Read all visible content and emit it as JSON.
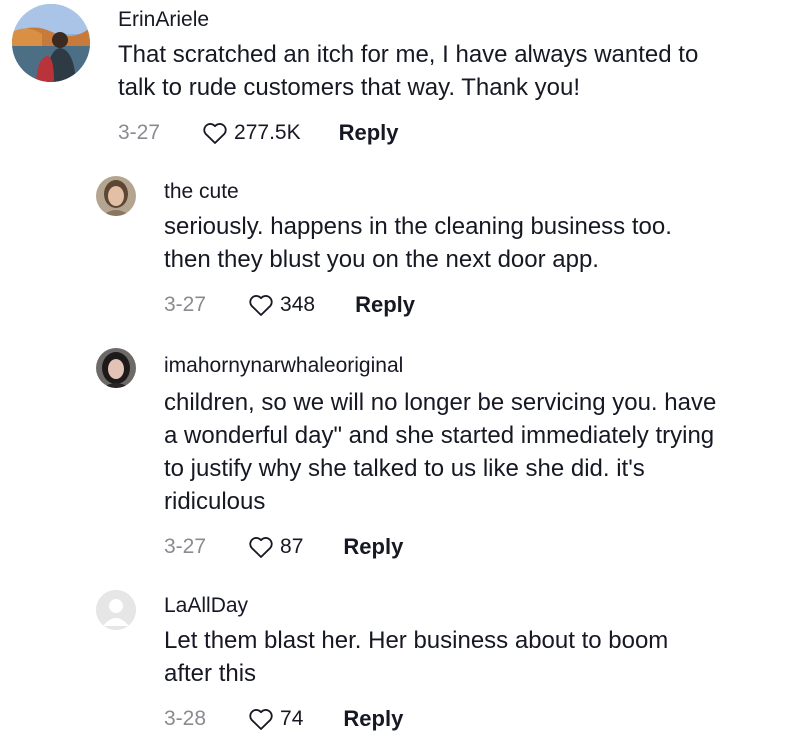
{
  "comments": [
    {
      "username": "ErinAriele",
      "lines": [
        "That scratched an itch for me, I have always wanted to",
        "talk to rude customers that way. Thank you!"
      ],
      "date": "3-27",
      "likes": "277.5K",
      "reply": "Reply",
      "avatar": "photo-avatar-outdoor"
    },
    {
      "username": "the cute",
      "lines": [
        "seriously. happens in the cleaning business too.",
        "then they blust you on the next door app."
      ],
      "date": "3-27",
      "likes": "348",
      "reply": "Reply",
      "avatar": "photo-avatar-person"
    },
    {
      "username": "imahornynarwhaleoriginal",
      "lines": [
        "children, so we will no longer be servicing you. have",
        "a wonderful day\" and she started immediately trying",
        "to justify why she talked to us like she did. it's",
        "ridiculous"
      ],
      "date": "3-27",
      "likes": "87",
      "reply": "Reply",
      "avatar": "photo-avatar-person"
    },
    {
      "username": "LaAllDay",
      "lines": [
        "Let them blast her. Her business about to boom",
        "after this"
      ],
      "date": "3-28",
      "likes": "74",
      "reply": "Reply",
      "avatar": "default-avatar-icon"
    }
  ],
  "icons": {
    "like": "heart-outline-icon"
  },
  "colors": {
    "text": "#161823",
    "muted": "#8a8b91",
    "default_avatar_bg": "#e3e3e3"
  }
}
